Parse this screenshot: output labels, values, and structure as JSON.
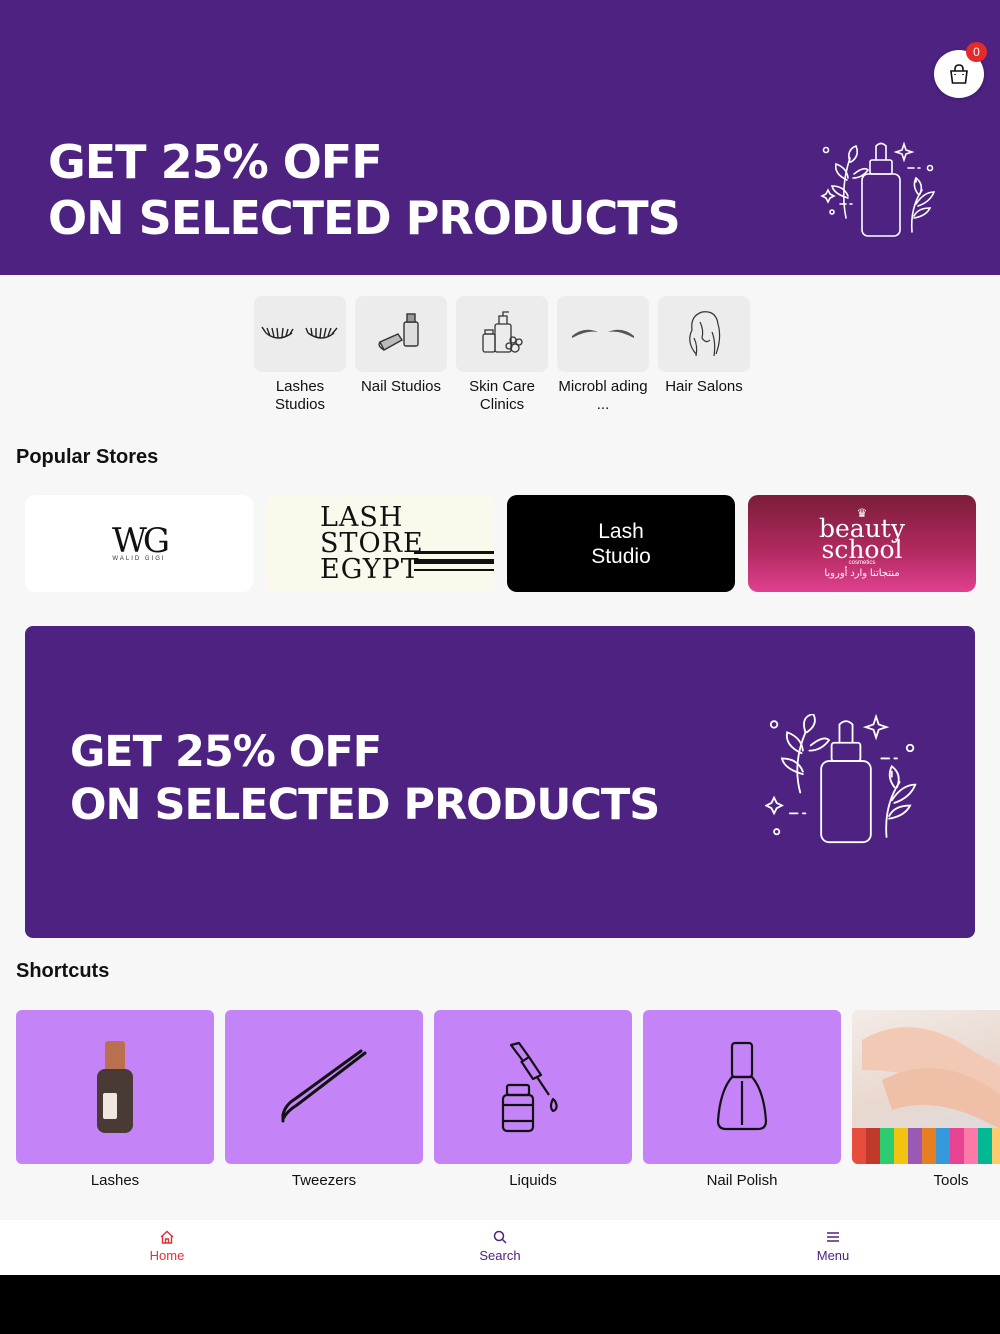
{
  "top_banner": {
    "line1": "GET 25% OFF",
    "line2": "ON SELECTED PRODUCTS",
    "background": "#4e2280"
  },
  "cart": {
    "icon": "shopping-bag-icon",
    "badge_count": "0"
  },
  "categories": [
    {
      "label": "Lashes Studios",
      "icon": "eyelashes-icon"
    },
    {
      "label": "Nail Studios",
      "icon": "nail-polish-icon"
    },
    {
      "label": "Skin Care Clinics",
      "icon": "skincare-bottles-icon"
    },
    {
      "label": "Microbl ading ...",
      "icon": "eyebrows-icon"
    },
    {
      "label": "Hair Salons",
      "icon": "hair-silhouette-icon"
    }
  ],
  "popular_stores": {
    "title": "Popular Stores",
    "stores": [
      {
        "name": "WG",
        "sub": "WALID GIGI"
      },
      {
        "name": "LASH STORE EGYPT"
      },
      {
        "name": "Lash Studio"
      },
      {
        "name": "beauty school",
        "sub": "cosmetics",
        "arabic": "منتجاتنا وارد أوروبا"
      }
    ]
  },
  "mid_banner": {
    "line1": "GET 25% OFF",
    "line2": "ON SELECTED PRODUCTS"
  },
  "shortcuts": {
    "title": "Shortcuts",
    "items": [
      {
        "label": "Lashes",
        "icon": "lash-glue-bottle-icon"
      },
      {
        "label": "Tweezers",
        "icon": "tweezers-icon"
      },
      {
        "label": "Liquids",
        "icon": "dropper-bottle-icon"
      },
      {
        "label": "Nail Polish",
        "icon": "nail-polish-bottle-icon"
      },
      {
        "label": "Tools",
        "icon": "nail-swatches-photo"
      }
    ],
    "tile_color": "#c484f8"
  },
  "bottom_nav": {
    "home": "Home",
    "search": "Search",
    "menu": "Menu",
    "active": "Home",
    "active_color": "#e0303a"
  }
}
